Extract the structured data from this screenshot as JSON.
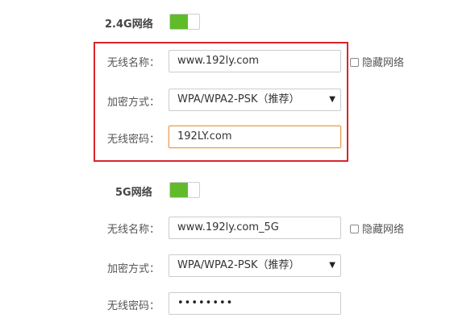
{
  "band_24g": {
    "title": "2.4G网络",
    "enabled": true,
    "ssid_label": "无线名称：",
    "ssid_value": "www.192ly.com",
    "hide_label": "隐藏网络",
    "encryption_label": "加密方式：",
    "encryption_value": "WPA/WPA2-PSK（推荐）",
    "password_label": "无线密码：",
    "password_value": "192LY.com"
  },
  "band_5g": {
    "title": "5G网络",
    "enabled": true,
    "ssid_label": "无线名称：",
    "ssid_value": "www.192ly.com_5G",
    "hide_label": "隐藏网络",
    "encryption_label": "加密方式：",
    "encryption_value": "WPA/WPA2-PSK（推荐）",
    "password_label": "无线密码：",
    "password_value": "••••••••"
  },
  "colors": {
    "toggle_on": "#5fbb2a",
    "highlight": "#d9252a",
    "focus": "#e39a48"
  },
  "icons": {
    "select_arrow": "triangle-down-icon",
    "checkbox": "checkbox-unchecked-icon"
  }
}
